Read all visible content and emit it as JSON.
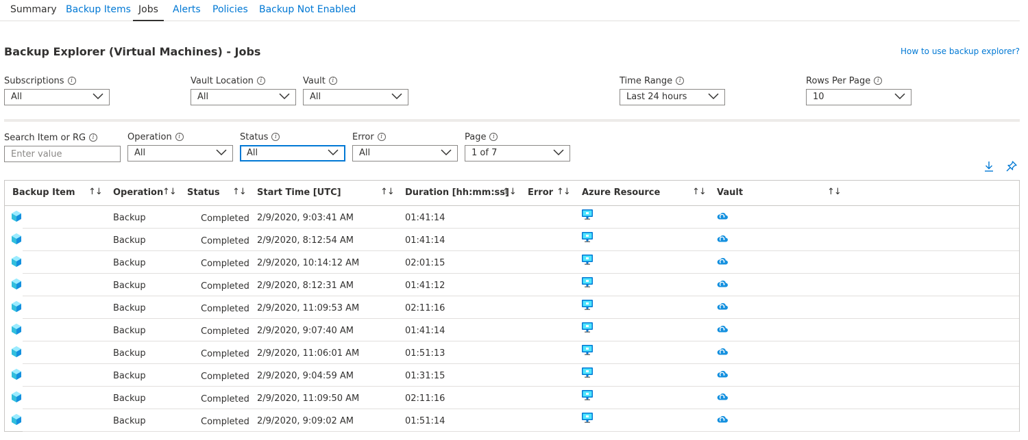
{
  "tabs": [
    {
      "label": "Summary"
    },
    {
      "label": "Backup Items"
    },
    {
      "label": "Jobs"
    },
    {
      "label": "Alerts"
    },
    {
      "label": "Policies"
    },
    {
      "label": "Backup Not Enabled"
    }
  ],
  "page": {
    "title": "Backup Explorer (Virtual Machines) - Jobs",
    "help_link": "How to use backup explorer?"
  },
  "filters_top": {
    "subscriptions": {
      "label": "Subscriptions",
      "value": "All"
    },
    "vault_location": {
      "label": "Vault Location",
      "value": "All"
    },
    "vault": {
      "label": "Vault",
      "value": "All"
    },
    "time_range": {
      "label": "Time Range",
      "value": "Last 24 hours"
    },
    "rows_per_page": {
      "label": "Rows Per Page",
      "value": "10"
    }
  },
  "filters_bottom": {
    "search": {
      "label": "Search Item or RG",
      "placeholder": "Enter value"
    },
    "operation": {
      "label": "Operation",
      "value": "All"
    },
    "status": {
      "label": "Status",
      "value": "All"
    },
    "error": {
      "label": "Error",
      "value": "All"
    },
    "page": {
      "label": "Page",
      "value": "1 of 7"
    }
  },
  "table": {
    "columns": [
      "Backup Item",
      "Operation",
      "Status",
      "Start Time [UTC]",
      "Duration [hh:mm:ss]",
      "Error",
      "Azure Resource",
      "Vault"
    ],
    "sort_glyph": "↑↓",
    "rows": [
      {
        "operation": "Backup",
        "status": "Completed",
        "start": "2/9/2020, 9:03:41 AM",
        "duration": "01:41:14"
      },
      {
        "operation": "Backup",
        "status": "Completed",
        "start": "2/9/2020, 8:12:54 AM",
        "duration": "01:41:14"
      },
      {
        "operation": "Backup",
        "status": "Completed",
        "start": "2/9/2020, 10:14:12 AM",
        "duration": "02:01:15"
      },
      {
        "operation": "Backup",
        "status": "Completed",
        "start": "2/9/2020, 8:12:31 AM",
        "duration": "01:41:12"
      },
      {
        "operation": "Backup",
        "status": "Completed",
        "start": "2/9/2020, 11:09:53 AM",
        "duration": "02:11:16"
      },
      {
        "operation": "Backup",
        "status": "Completed",
        "start": "2/9/2020, 9:07:40 AM",
        "duration": "01:41:14"
      },
      {
        "operation": "Backup",
        "status": "Completed",
        "start": "2/9/2020, 11:06:01 AM",
        "duration": "01:51:13"
      },
      {
        "operation": "Backup",
        "status": "Completed",
        "start": "2/9/2020, 9:04:59 AM",
        "duration": "01:31:15"
      },
      {
        "operation": "Backup",
        "status": "Completed",
        "start": "2/9/2020, 11:09:50 AM",
        "duration": "02:11:16"
      },
      {
        "operation": "Backup",
        "status": "Completed",
        "start": "2/9/2020, 9:09:02 AM",
        "duration": "01:51:14"
      }
    ]
  },
  "icons": {
    "backup_item": "vm-cube-icon",
    "azure_resource": "virtual-machine-monitor-icon",
    "vault": "recovery-vault-cloud-icon",
    "download": "download-icon",
    "pin": "pin-icon",
    "info": "info-icon",
    "chevron": "chevron-down-icon"
  },
  "colors": {
    "accent": "#0078d4",
    "text": "#323130",
    "border": "#8a8886"
  }
}
